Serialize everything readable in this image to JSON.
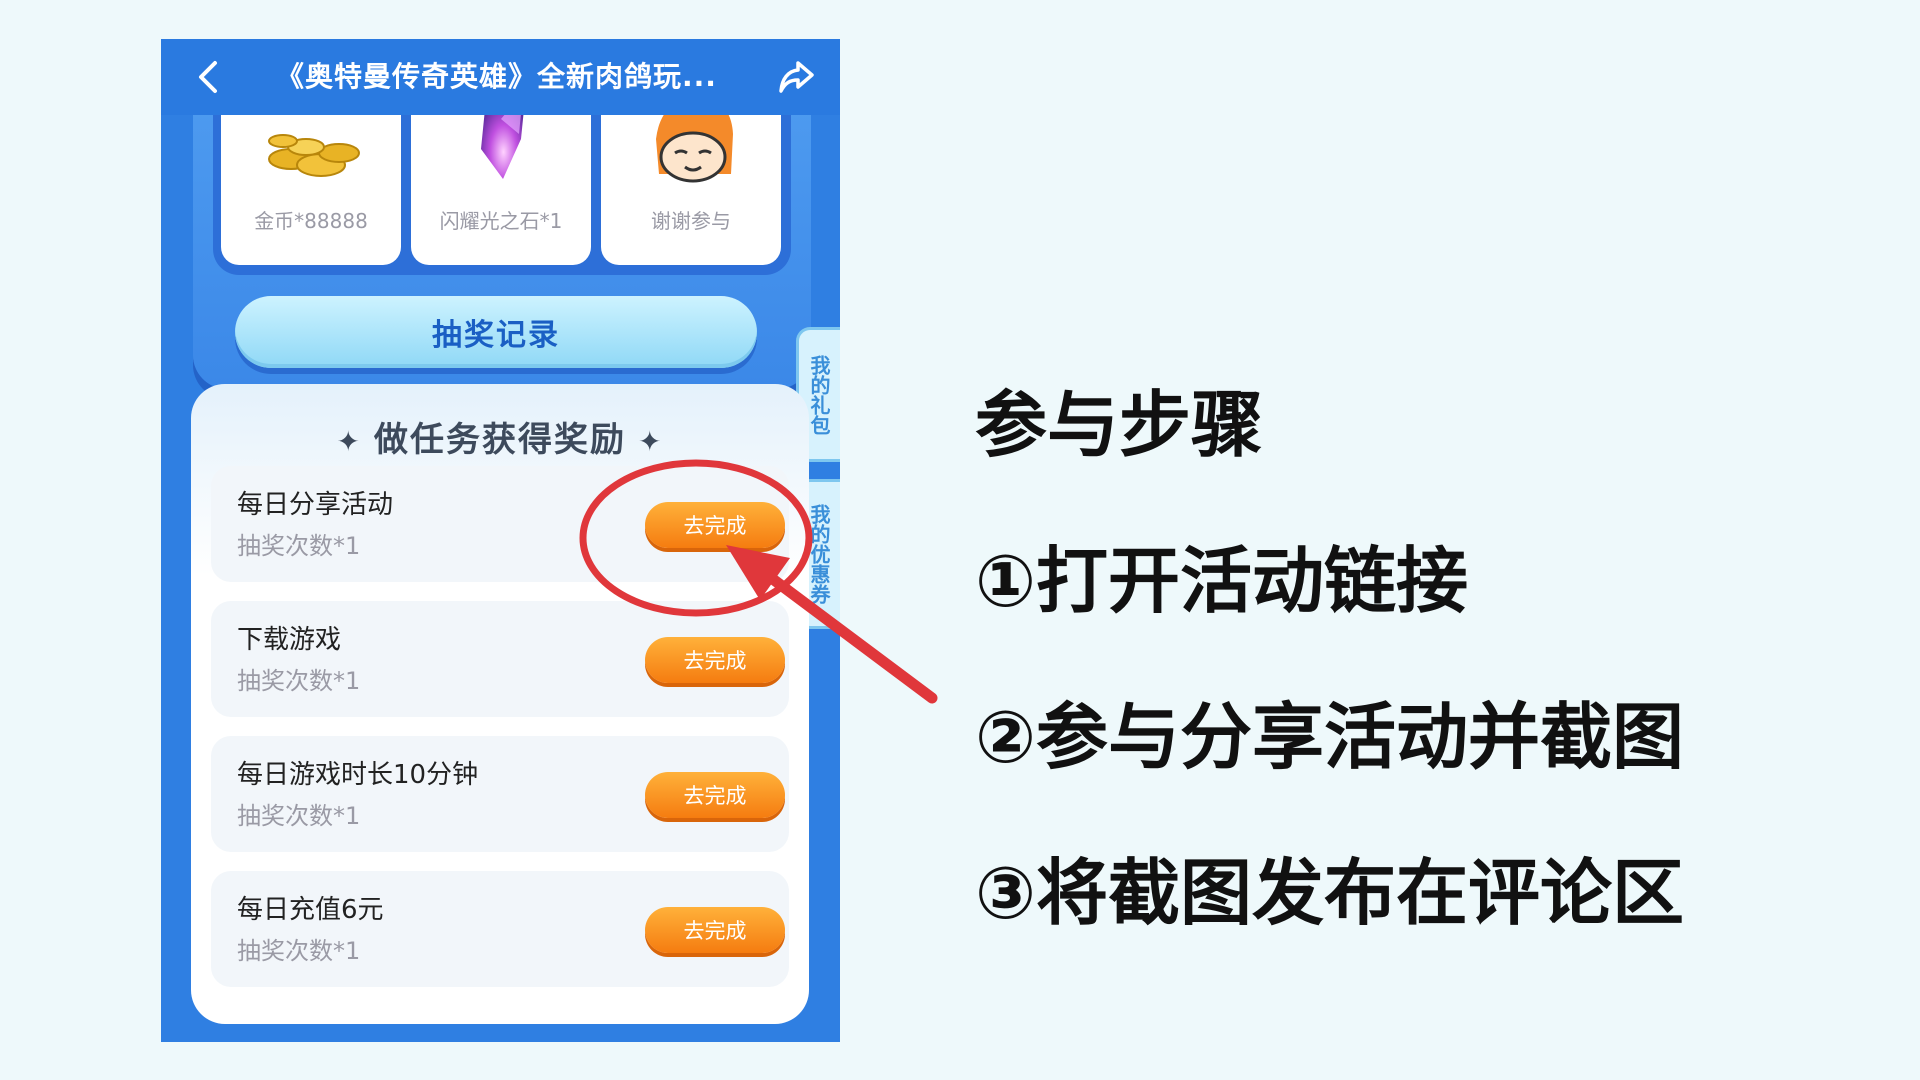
{
  "topbar": {
    "title": "《奥特曼传奇英雄》全新肉鸽玩..."
  },
  "prizes": [
    {
      "label": "金币*88888",
      "icon": "gold-coins-icon"
    },
    {
      "label": "闪耀光之石*1",
      "icon": "crystal-stone-icon"
    },
    {
      "label": "谢谢参与",
      "icon": "thanks-face-icon"
    }
  ],
  "record_button": "抽奖记录",
  "side_tabs": {
    "gift": "我的礼包",
    "coupon": "我的优惠券"
  },
  "tasks": {
    "heading": "做任务获得奖励",
    "items": [
      {
        "name": "每日分享活动",
        "sub": "抽奖次数*1",
        "button": "去完成"
      },
      {
        "name": "下载游戏",
        "sub": "抽奖次数*1",
        "button": "去完成"
      },
      {
        "name": "每日游戏时长10分钟",
        "sub": "抽奖次数*1",
        "button": "去完成"
      },
      {
        "name": "每日充值6元",
        "sub": "抽奖次数*1",
        "button": "去完成"
      }
    ]
  },
  "steps": {
    "title": "参与步骤",
    "step1": "①打开活动链接",
    "step2": "②参与分享活动并截图",
    "step3": "③将截图发布在评论区"
  },
  "colors": {
    "annotation_red": "#e0373b",
    "accent_blue": "#2a7ae0",
    "button_orange": "#f57c10"
  }
}
